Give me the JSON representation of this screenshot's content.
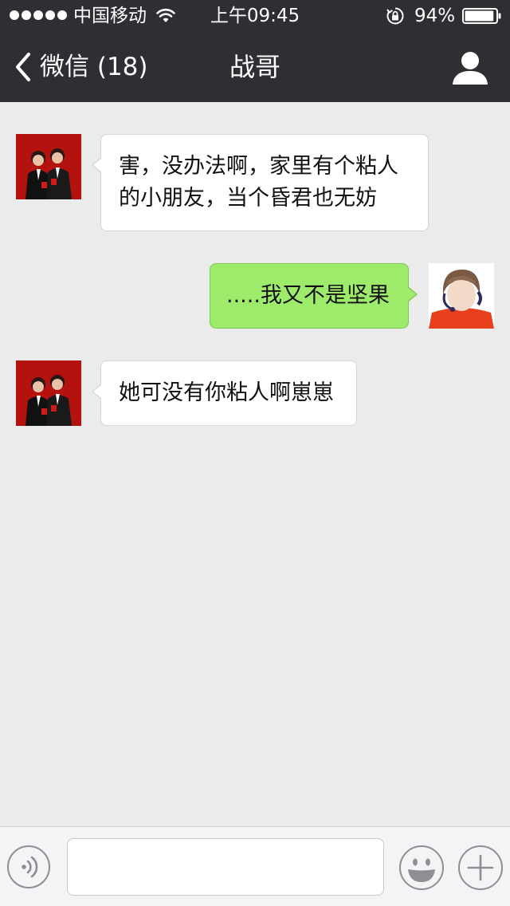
{
  "status_bar": {
    "carrier": "中国移动",
    "time": "上午09:45",
    "battery_percent": "94%",
    "battery_level": 0.94,
    "signal_dots": 5,
    "icons": [
      "signal-dots-icon",
      "wifi-icon",
      "orientation-lock-icon",
      "battery-icon"
    ]
  },
  "nav": {
    "back_label": "微信 (18)",
    "title": "战哥",
    "back_icon": "chevron-left-icon",
    "profile_icon": "person-icon"
  },
  "messages": [
    {
      "side": "left",
      "avatar": "contact-avatar-photo",
      "lines": [
        "害，没办法啊，家里有个粘人",
        "的小朋友，当个昏君也无妨"
      ]
    },
    {
      "side": "right",
      "avatar": "my-avatar-photo",
      "lines": [
        ".....我又不是坚果"
      ]
    },
    {
      "side": "left",
      "avatar": "contact-avatar-photo",
      "lines": [
        "她可没有你粘人啊崽崽"
      ]
    }
  ],
  "input_bar": {
    "text_value": "",
    "icons": [
      "voice-mode-icon",
      "emoji-icon",
      "plus-icon"
    ]
  },
  "colors": {
    "top_bar": "#2e2e33",
    "chat_background": "#ebebeb",
    "bubble_incoming": "#ffffff",
    "bubble_outgoing": "#9eea6a",
    "input_bar": "#f4f4f6"
  }
}
